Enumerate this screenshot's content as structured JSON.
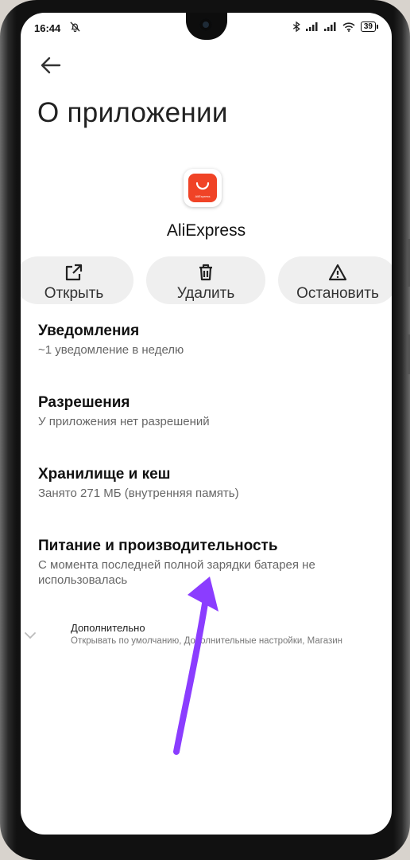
{
  "status_bar": {
    "time": "16:44",
    "battery": "39"
  },
  "header": {
    "title": "О приложении"
  },
  "app": {
    "name": "AliExpress",
    "icon_label": "AliExpress",
    "brand_color": "#f04326"
  },
  "actions": [
    {
      "label": "Открыть",
      "icon": "open-external-icon"
    },
    {
      "label": "Удалить",
      "icon": "trash-icon"
    },
    {
      "label": "Остановить",
      "icon": "warning-icon"
    }
  ],
  "settings": [
    {
      "title": "Уведомления",
      "subtitle": "~1 уведомление в неделю"
    },
    {
      "title": "Разрешения",
      "subtitle": "У приложения нет разрешений"
    },
    {
      "title": "Хранилище и кеш",
      "subtitle": "Занято 271 МБ (внутренняя память)"
    },
    {
      "title": "Питание и производительность",
      "subtitle": "С момента последней полной зарядки батарея не использовалась"
    }
  ],
  "extra": {
    "title": "Дополнительно",
    "subtitle": "Открывать по умолчанию, Дополнительные настройки, Магазин"
  },
  "annotation": {
    "color": "#8b3dff"
  }
}
